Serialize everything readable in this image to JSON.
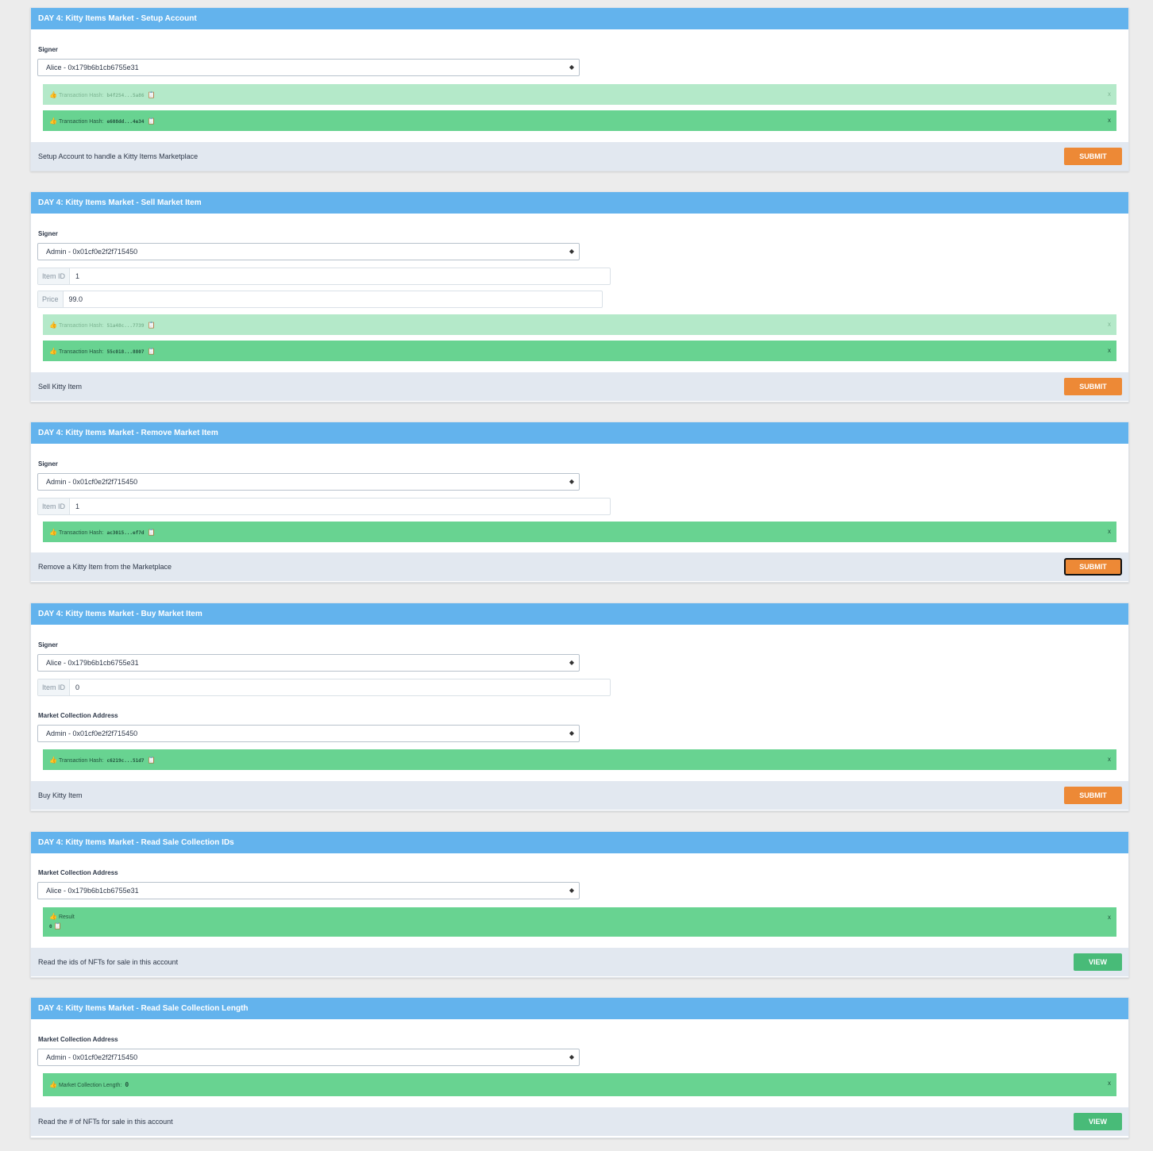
{
  "cards": [
    {
      "title": "DAY 4: Kitty Items Market - Setup Account",
      "signer_label": "Signer",
      "signer_value": "Alice - 0x179b6b1cb6755e31",
      "alerts": [
        {
          "label": "Transaction Hash:",
          "hash": "b4f254...5a86"
        },
        {
          "label": "Transaction Hash:",
          "hash": "e608dd...4e34"
        }
      ],
      "description": "Setup Account to handle a Kitty Items Marketplace",
      "button": "SUBMIT"
    },
    {
      "title": "DAY 4: Kitty Items Market - Sell Market Item",
      "signer_label": "Signer",
      "signer_value": "Admin - 0x01cf0e2f2f715450",
      "item_id_label": "Item ID",
      "item_id_value": "1",
      "price_label": "Price",
      "price_value": "99.0",
      "alerts": [
        {
          "label": "Transaction Hash:",
          "hash": "51a48c...7739"
        },
        {
          "label": "Transaction Hash:",
          "hash": "55c018...8807"
        }
      ],
      "description": "Sell Kitty Item",
      "button": "SUBMIT"
    },
    {
      "title": "DAY 4: Kitty Items Market - Remove Market Item",
      "signer_label": "Signer",
      "signer_value": "Admin - 0x01cf0e2f2f715450",
      "item_id_label": "Item ID",
      "item_id_value": "1",
      "alerts": [
        {
          "label": "Transaction Hash:",
          "hash": "ac3015...ef7d"
        }
      ],
      "description": "Remove a Kitty Item from the Marketplace",
      "button": "SUBMIT"
    },
    {
      "title": "DAY 4: Kitty Items Market - Buy Market Item",
      "signer_label": "Signer",
      "signer_value": "Alice - 0x179b6b1cb6755e31",
      "item_id_label": "Item ID",
      "item_id_value": "0",
      "market_label": "Market Collection Address",
      "market_value": "Admin - 0x01cf0e2f2f715450",
      "alerts": [
        {
          "label": "Transaction Hash:",
          "hash": "c6219c...51d7"
        }
      ],
      "description": "Buy Kitty Item",
      "button": "SUBMIT"
    },
    {
      "title": "DAY 4: Kitty Items Market - Read Sale Collection IDs",
      "market_label": "Market Collection Address",
      "market_value": "Alice - 0x179b6b1cb6755e31",
      "result_label": "Result",
      "result_value": "0",
      "description": "Read the ids of NFTs for sale in this account",
      "button": "VIEW"
    },
    {
      "title": "DAY 4: Kitty Items Market - Read Sale Collection Length",
      "market_label": "Market Collection Address",
      "market_value": "Admin - 0x01cf0e2f2f715450",
      "length_label": "Market Collection Length:",
      "length_value": "0",
      "description": "Read the # of NFTs for sale in this account",
      "button": "VIEW"
    }
  ],
  "icons": {
    "thumbs_up": "👍",
    "clipboard": "📋",
    "close": "x",
    "select_arrow": "◆"
  },
  "colors": {
    "header": "#63b3ed",
    "submit": "#ed8936",
    "view": "#48bb78",
    "alert_dark": "#68d391",
    "alert_light": "#b4e9c9",
    "footer": "#e2e8f0"
  }
}
